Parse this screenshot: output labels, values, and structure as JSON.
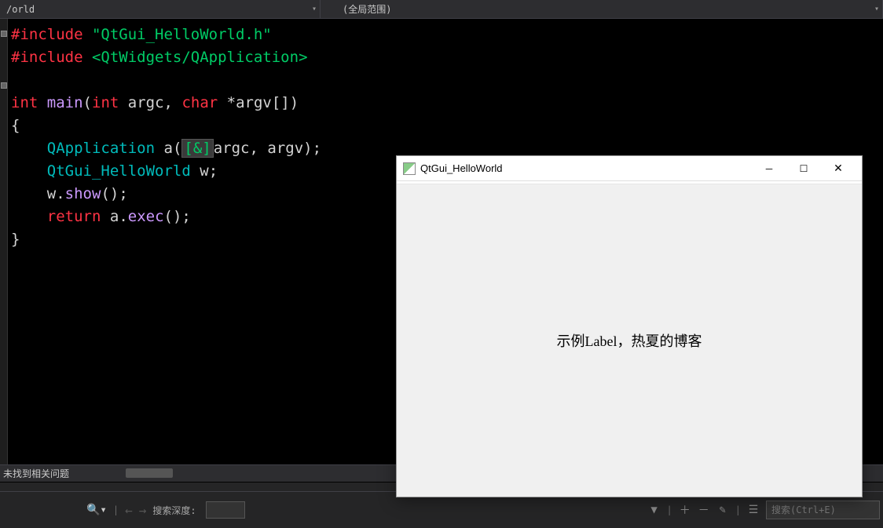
{
  "scope": {
    "left": "/orld",
    "right": "(全局范围)"
  },
  "code": {
    "l1a": "#include",
    "l1b": "\"QtGui_HelloWorld.h\"",
    "l2a": "#include",
    "l2b": "<QtWidgets/QApplication>",
    "l4a": "int",
    "l4b": "main",
    "l4c": "int",
    "l4d": "argc",
    "l4e": "char",
    "l4f": "*argv[]",
    "l5": "{",
    "l6a": "QApplication",
    "l6b": "a",
    "l6amp": "[&]",
    "l6c": "argc",
    "l6d": "argv",
    "l7a": "QtGui_HelloWorld",
    "l7b": "w",
    "l8a": "w",
    "l8b": "show",
    "l9a": "return",
    "l9b": "a",
    "l9c": "exec",
    "l10": "}"
  },
  "bottom": {
    "no_issues": "未找到相关问题",
    "search_depth_label": "搜索深度:",
    "search_placeholder": "搜索(Ctrl+E)"
  },
  "app": {
    "title": "QtGui_HelloWorld",
    "label_text": "示例Label，热夏的博客"
  }
}
